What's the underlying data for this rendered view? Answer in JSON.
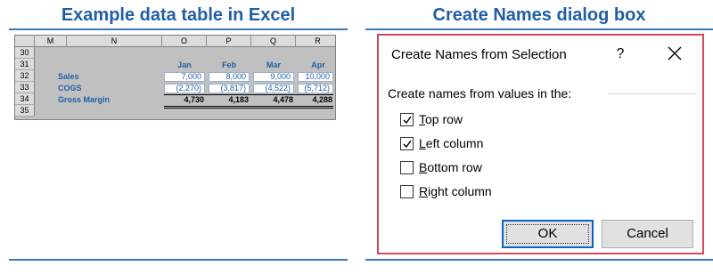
{
  "left_title": "Example data table in Excel",
  "right_title": "Create Names dialog box",
  "sheet": {
    "columns": [
      "M",
      "N",
      "O",
      "P",
      "Q",
      "R"
    ],
    "rows": [
      "30",
      "31",
      "32",
      "33",
      "34",
      "35"
    ],
    "months": [
      "Jan",
      "Feb",
      "Mar",
      "Apr"
    ],
    "labels": [
      "Sales",
      "COGS",
      "Gross Margin"
    ],
    "sales": [
      "7,000",
      "8,000",
      "9,000",
      "10,000"
    ],
    "cogs": [
      "(2,270)",
      "(3,817)",
      "(4,522)",
      "(5,712)"
    ],
    "margin": [
      "4,730",
      "4,183",
      "4,478",
      "4,288"
    ]
  },
  "dialog": {
    "title": "Create Names from Selection",
    "help": "?",
    "group_label": "Create names from values in the:",
    "options": [
      {
        "key": "T",
        "rest": "op row",
        "checked": true
      },
      {
        "key": "L",
        "rest": "eft column",
        "checked": true
      },
      {
        "key": "B",
        "rest": "ottom row",
        "checked": false
      },
      {
        "key": "R",
        "rest": "ight column",
        "checked": false
      }
    ],
    "ok_label": "OK",
    "cancel_label": "Cancel"
  },
  "colors": {
    "accent": "#1f5fa8",
    "dialog_border": "#d9475a",
    "ok_focus": "#0a64c8"
  }
}
